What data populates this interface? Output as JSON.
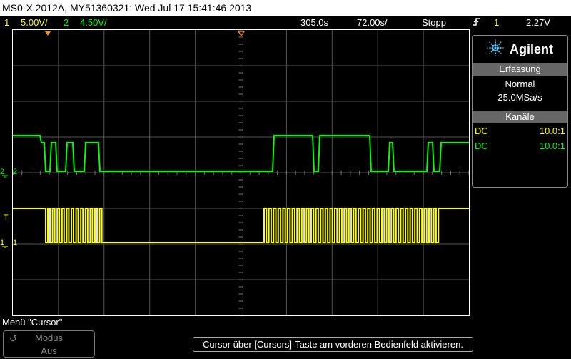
{
  "titlebar": {
    "text": "MS0-X 2012A, MY51360321: Wed Jul 17 15:41:46 2013"
  },
  "status": {
    "ch1_num": "1",
    "ch1_scale": "5.00V/",
    "ch2_num": "2",
    "ch2_scale": "4.50V/",
    "time_offset": "305.0s",
    "time_scale": "72.00s/",
    "run_state": "Stopp",
    "trigger_icon": "trigger-edge-icon",
    "trigger_channel": "1",
    "trigger_level": "2.27V"
  },
  "sidepanel": {
    "brand": "Agilent",
    "acquisition_header": "Erfassung",
    "acquisition_mode": "Normal",
    "sample_rate": "25.0MSa/s",
    "channels_header": "Kanäle",
    "channels": [
      {
        "coupling": "DC",
        "probe": "10.0:1",
        "color": "#ffff00"
      },
      {
        "coupling": "DC",
        "probe": "10.0:1",
        "color": "#00ff00"
      }
    ]
  },
  "markers": {
    "ch2_label": "2",
    "ch1_label": "1",
    "trigger_label": "T"
  },
  "menu": {
    "title": "Menü \"Cursor\"",
    "softkey_line1": "Modus",
    "softkey_line2": "Aus"
  },
  "message": "Cursor über [Cursors]-Taste am vorderen Bedienfeld aktivieren.",
  "colors": {
    "ch1": "#ffff00",
    "ch2": "#00ff00",
    "grid": "#555555",
    "accent": "#ff8c1a"
  }
}
